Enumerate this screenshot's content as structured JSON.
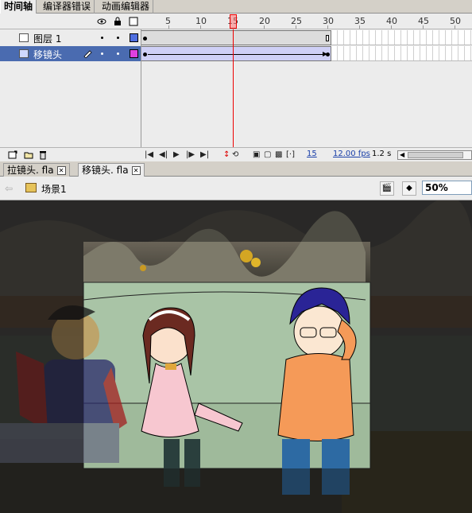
{
  "panel_tabs": [
    "时间轴",
    "编译器错误",
    "动画编辑器"
  ],
  "timeline": {
    "ruler_numbers": [
      "5",
      "10",
      "15",
      "20",
      "25",
      "30",
      "35",
      "40",
      "45",
      "50"
    ],
    "current_frame_marker": "15",
    "layers": [
      {
        "name": "图层 1",
        "selected": false,
        "color": "#4f6fe0"
      },
      {
        "name": "移镜头",
        "selected": true,
        "color": "#e040e0"
      }
    ],
    "status": {
      "frame": "15",
      "fps": "12.00 fps",
      "time": "1.2 s"
    }
  },
  "document_tabs": [
    {
      "label": "拉镜头. fla",
      "active": false
    },
    {
      "label": "移镜头. fla",
      "active": true
    }
  ],
  "edit_bar": {
    "scene": "场景1",
    "zoom": "50%"
  },
  "colors": {
    "panel": "#ececec",
    "selected_layer": "#4a6bb0",
    "tween_span": "#cfd0f6",
    "playhead": "#e00000",
    "stage_bg": "#3d3d3d",
    "sofa": "#a9c4a6"
  },
  "icons": {
    "eye": "eye-icon",
    "lock": "lock-icon",
    "outline": "outline-icon",
    "pencil": "pencil-icon",
    "new_layer": "new-layer-icon",
    "folder": "folder-icon",
    "trash": "trash-icon",
    "scene": "scene-icon"
  }
}
